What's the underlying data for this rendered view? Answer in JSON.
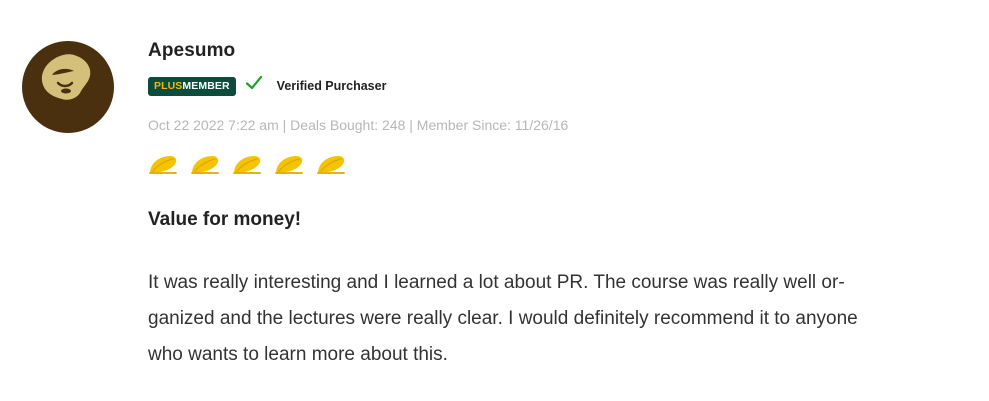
{
  "review": {
    "author": "Apesumo",
    "badge": {
      "plus": "PLUS",
      "member": "MEMBER",
      "color": "#0d4b3c",
      "plus_color": "#f5b800"
    },
    "verified_icon": "check-icon",
    "verified_label": "Verified Purchaser",
    "meta": "Oct 22 2022 7:22 am | Deals Bought: 248 | Member Since: 11/26/16",
    "rating": {
      "value": 5,
      "max": 5,
      "icon": "taco-rating-icon",
      "color": "#f5c400"
    },
    "title": "Value for money!",
    "body_lines": [
      "It was really interesting and I learned a lot about PR. The course was really well or-",
      "ganized and the lectures were really clear. I would definitely recommend it to anyone",
      "who wants to learn more about this."
    ]
  },
  "colors": {
    "avatar_background": "#4a300f",
    "avatar_face": "#d4c07a",
    "check": "#1fa02e",
    "meta_text": "#b7b7b7"
  }
}
